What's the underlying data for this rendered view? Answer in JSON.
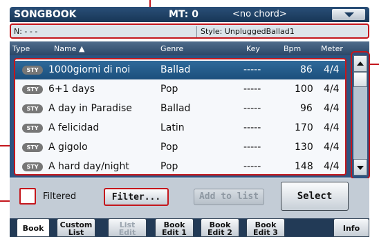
{
  "title_bar": {
    "app_title": "SONGBOOK",
    "mt_label": "MT: 0",
    "chord_label": "<no chord>"
  },
  "info_bar": {
    "n_label": "N: - - -",
    "style_label": "Style: UnpluggedBallad1"
  },
  "columns": {
    "type": "Type",
    "name": "Name ▲",
    "genre": "Genre",
    "key": "Key",
    "bpm": "Bpm",
    "meter": "Meter"
  },
  "rows": [
    {
      "badge": "STY",
      "name": "1000giorni di noi",
      "genre": "Ballad",
      "key": "-----",
      "bpm": "86",
      "meter": "4/4"
    },
    {
      "badge": "STY",
      "name": "6+1 days",
      "genre": "Pop",
      "key": "-----",
      "bpm": "100",
      "meter": "4/4"
    },
    {
      "badge": "STY",
      "name": "A day in Paradise",
      "genre": "Ballad",
      "key": "-----",
      "bpm": "96",
      "meter": "4/4"
    },
    {
      "badge": "STY",
      "name": "A felicidad",
      "genre": "Latin",
      "key": "-----",
      "bpm": "170",
      "meter": "4/4"
    },
    {
      "badge": "STY",
      "name": "A gigolo",
      "genre": "Pop",
      "key": "-----",
      "bpm": "130",
      "meter": "4/4"
    },
    {
      "badge": "STY",
      "name": "A hard day/night",
      "genre": "Pop",
      "key": "-----",
      "bpm": "148",
      "meter": "4/4"
    }
  ],
  "controls": {
    "filtered_label": "Filtered",
    "filter_button": "Filter...",
    "add_button": "Add to list",
    "select_button": "Select"
  },
  "tabs": [
    {
      "line1": "Book",
      "line2": ""
    },
    {
      "line1": "Custom",
      "line2": "List"
    },
    {
      "line1": "List",
      "line2": "Edit"
    },
    {
      "line1": "Book",
      "line2": "Edit 1"
    },
    {
      "line1": "Book",
      "line2": "Edit 2"
    },
    {
      "line1": "Book",
      "line2": "Edit 3"
    },
    {
      "line1": "Info",
      "line2": ""
    }
  ],
  "colors": {
    "callout": "#c4161c",
    "title_bg": "#1f3f63",
    "selected_row": "#245b8a"
  }
}
